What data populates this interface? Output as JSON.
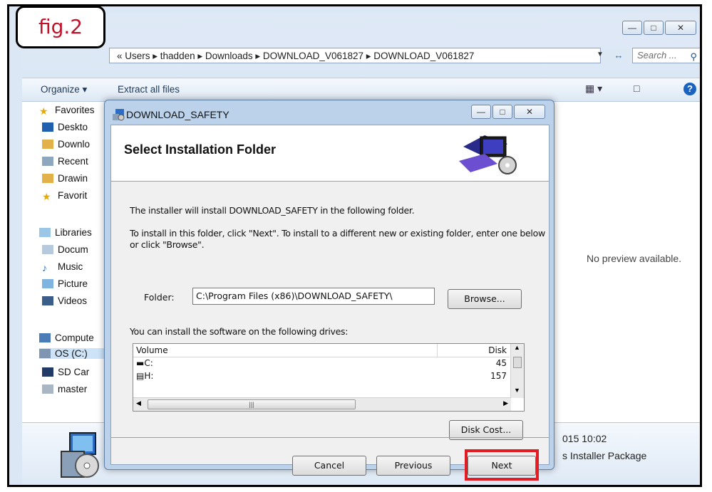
{
  "figure": {
    "label": "fig.2"
  },
  "explorer": {
    "breadcrumb": "« Users ▸ thadden ▸ Downloads ▸ DOWNLOAD_V061827 ▸ DOWNLOAD_V061827",
    "search_placeholder": "Search ...",
    "toolbar": {
      "organize": "Organize ▾",
      "extract": "Extract all files"
    },
    "nav": {
      "favorites": "Favorites",
      "desktop": "Deskto",
      "downloads": "Downlo",
      "recent": "Recent",
      "drawings": "Drawin",
      "favorites2": "Favorit",
      "libraries": "Libraries",
      "documents": "Docum",
      "music": "Music",
      "pictures": "Picture",
      "videos": "Videos",
      "computer": "Compute",
      "os": "OS (C:)",
      "sdcard": "SD Car",
      "master": "master"
    },
    "preview_text": "No preview available.",
    "details": {
      "date": "015 10:02",
      "type": "s Installer Package"
    }
  },
  "dialog": {
    "title": "DOWNLOAD_SAFETY",
    "heading": "Select Installation Folder",
    "intro": "The installer will install DOWNLOAD_SAFETY in the following folder.",
    "instructions_line1": "To install in this folder, click \"Next\". To install to a different new or existing folder, enter one below",
    "instructions_line2": "or click \"Browse\".",
    "folder_label": "Folder:",
    "folder_value": "C:\\Program Files (x86)\\DOWNLOAD_SAFETY\\",
    "browse_label": "Browse...",
    "drives_label": "You can install the software on the following drives:",
    "drive_columns": {
      "volume": "Volume",
      "disk": "Disk"
    },
    "drives": [
      {
        "volume": "C:",
        "disk": "45"
      },
      {
        "volume": "H:",
        "disk": "157"
      }
    ],
    "disk_cost_label": "Disk Cost...",
    "cancel_label": "Cancel",
    "previous_label": "Previous",
    "next_label": "Next"
  },
  "colors": {
    "highlight": "#e31b23",
    "figure_label": "#c0122a"
  }
}
